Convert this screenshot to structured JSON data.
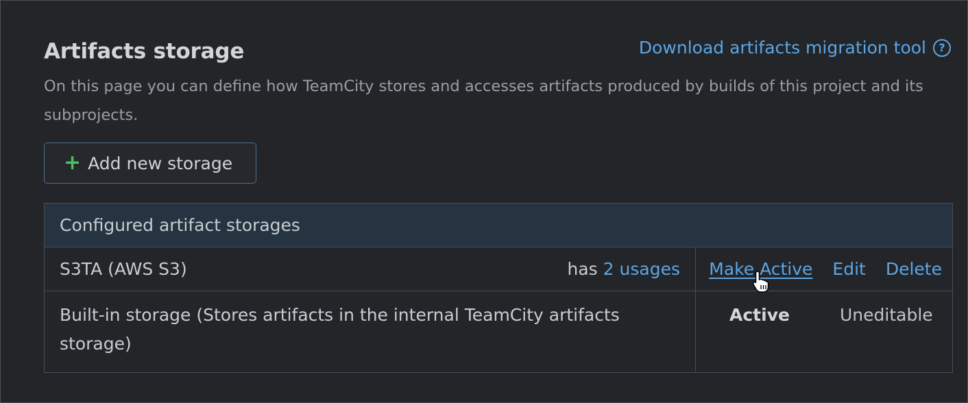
{
  "page": {
    "title": "Artifacts storage",
    "migration_link": "Download artifacts migration tool",
    "help_glyph": "?",
    "description": "On this page you can define how TeamCity stores and accesses artifacts produced by builds of this project and its subprojects."
  },
  "add_button": {
    "icon": "+",
    "label": "Add new storage"
  },
  "table": {
    "header": "Configured artifact storages",
    "rows": [
      {
        "name": "S3TA (AWS S3)",
        "usage_prefix": "has",
        "usage_link": "2 usages",
        "actions": [
          "Make Active",
          "Edit",
          "Delete"
        ]
      },
      {
        "name": "Built-in storage (Stores artifacts in the internal TeamCity artifacts storage)",
        "status": "Active",
        "editability": "Uneditable"
      }
    ]
  },
  "colors": {
    "background": "#232529",
    "link": "#5aa6e6",
    "plus": "#4dbf5e",
    "table_header": "#253440"
  }
}
